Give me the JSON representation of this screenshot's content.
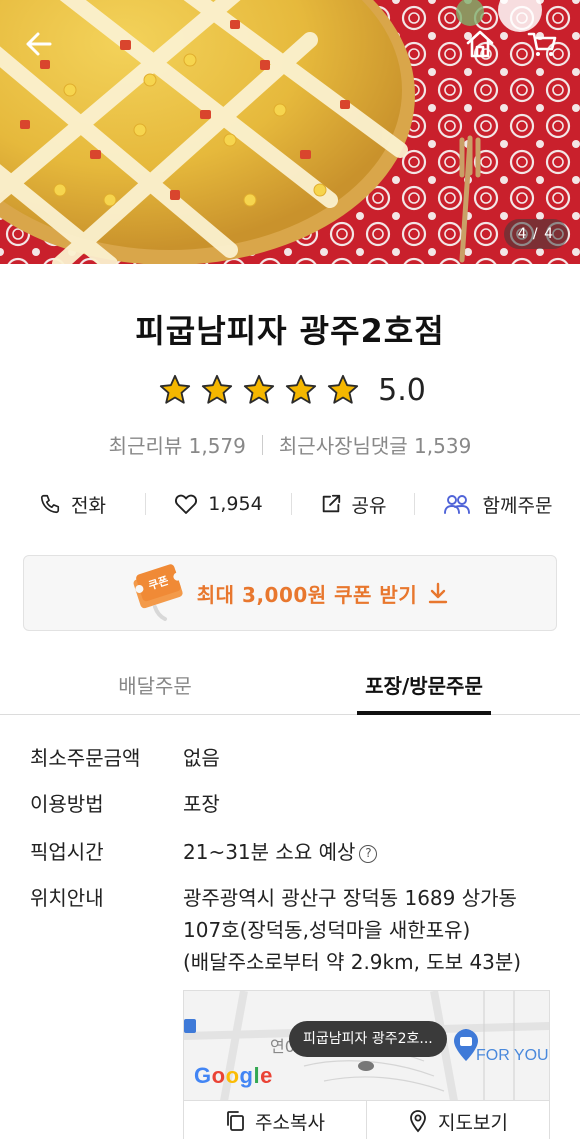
{
  "hero": {
    "page_indicator": "4 / 4",
    "icons": [
      "back-arrow-icon",
      "home-icon",
      "cart-icon"
    ]
  },
  "store": {
    "name": "피굽남피자 광주2호점",
    "rating": "5.0",
    "star_count": 5,
    "star_color": "#f5b700",
    "recent_reviews": "최근리뷰 1,579",
    "owner_replies": "최근사장님댓글 1,539"
  },
  "actions": {
    "call": "전화",
    "likes": "1,954",
    "share": "공유",
    "group_order": "함께주문"
  },
  "coupon": {
    "label": "최대 3,000원 쿠폰 받기",
    "ticket_text": "쿠폰",
    "accent": "#e8772e"
  },
  "tabs": {
    "delivery": "배달주문",
    "pickup": "포장/방문주문",
    "active": "pickup"
  },
  "info": {
    "min_order_label": "최소주문금액",
    "min_order_value": "없음",
    "method_label": "이용방법",
    "method_value": "포장",
    "pickup_time_label": "픽업시간",
    "pickup_time_value": "21~31분 소요 예상",
    "location_label": "위치안내",
    "address_line1": "광주광역시 광산구 장덕동 1689 상가동",
    "address_line2": "107호(장덕동,성덕마을 새한포유)",
    "distance": "(배달주소로부터 약 2.9km, 도보 43분)"
  },
  "map": {
    "pin_label": "피굽남피자 광주2호...",
    "google": "Google",
    "road_label": "연0",
    "place_label": "FOR YOU",
    "copy_address": "주소복사",
    "view_map": "지도보기"
  }
}
